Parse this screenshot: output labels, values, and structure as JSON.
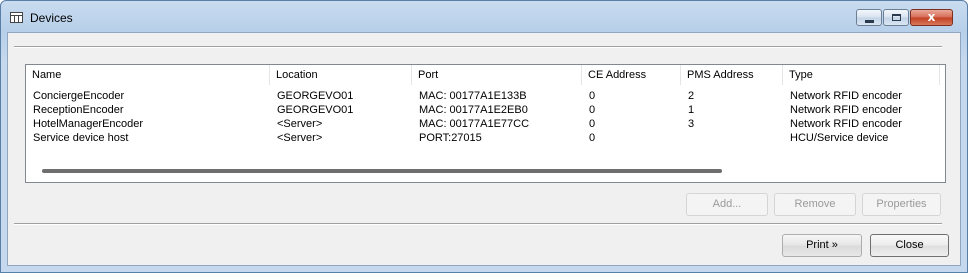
{
  "window": {
    "title": "Devices",
    "icon": "table-grid-icon",
    "caption_buttons": {
      "minimize": "minimize-icon",
      "maximize": "maximize-icon",
      "close": "close-icon",
      "close_glyph": "x"
    }
  },
  "devices_table": {
    "columns": [
      "Name",
      "Location",
      "Port",
      "CE Address",
      "PMS Address",
      "Type"
    ],
    "rows": [
      [
        "ConciergeEncoder",
        "GEORGEVO01",
        "MAC: 00177A1E133B",
        "0",
        "2",
        "Network RFID encoder"
      ],
      [
        "ReceptionEncoder",
        "GEORGEVO01",
        "MAC: 00177A1E2EB0",
        "0",
        "1",
        "Network RFID encoder"
      ],
      [
        "HotelManagerEncoder",
        "<Server>",
        "MAC: 00177A1E77CC",
        "0",
        "3",
        "Network RFID encoder"
      ],
      [
        "Service device host",
        "<Server>",
        "PORT:27015",
        "0",
        "",
        "HCU/Service device"
      ]
    ]
  },
  "actions": {
    "add_label": "Add...",
    "remove_label": "Remove",
    "properties_label": "Properties"
  },
  "footer": {
    "print_label": "Print »",
    "close_label": "Close"
  },
  "colors": {
    "title_bar": "#b7cfe9",
    "close_button": "#c23f22",
    "dialog_bg": "#f0f0f0"
  }
}
